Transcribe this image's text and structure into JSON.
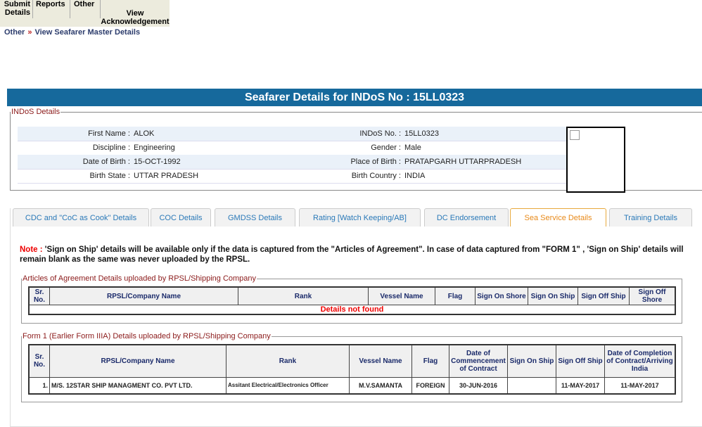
{
  "menu": [
    "Submit Details",
    "Reports",
    "Other",
    "View Acknowledgement"
  ],
  "breadcrumb": {
    "parent": "Other",
    "sep": "»",
    "current": "View Seafarer Master Details"
  },
  "title": "Seafarer Details for INDoS No : 15LL0323",
  "indos": {
    "legend": "INDoS Details",
    "rows": [
      {
        "l1": "First Name :",
        "v1": "ALOK",
        "l2": "INDoS No. :",
        "v2": "15LL0323"
      },
      {
        "l1": "Discipline :",
        "v1": "Engineering",
        "l2": "Gender :",
        "v2": "Male"
      },
      {
        "l1": "Date of Birth :",
        "v1": "15-OCT-1992",
        "l2": "Place of Birth :",
        "v2": "PRATAPGARH UTTARPRADESH"
      },
      {
        "l1": "Birth State :",
        "v1": "UTTAR PRADESH",
        "l2": "Birth Country :",
        "v2": "INDIA"
      }
    ]
  },
  "tabs": [
    "CDC and \"CoC as Cook\" Details",
    "COC Details",
    "GMDSS Details",
    "Rating [Watch Keeping/AB]",
    "DC Endorsement",
    "Sea Service Details",
    "Training Details"
  ],
  "note": {
    "label": "Note :",
    "text": " 'Sign on Ship' details will be available only if the data is captured from the \"Articles of Agreement\". In case of data captured from \"FORM 1\" , 'Sign on Ship' details will remain blank as the same was never uploaded by the RPSL."
  },
  "articles": {
    "legend": "Articles of Agreement Details uploaded by RPSL/Shipping Company",
    "headers": [
      "Sr. No.",
      "RPSL/Company Name",
      "Rank",
      "Vessel Name",
      "Flag",
      "Sign On Shore",
      "Sign On Ship",
      "Sign Off Ship",
      "Sign Off Shore"
    ],
    "empty": "Details not found"
  },
  "form1": {
    "legend": "Form 1 (Earlier Form IIIA) Details uploaded by RPSL/Shipping Company",
    "headers": [
      "Sr. No.",
      "RPSL/Company Name",
      "Rank",
      "Vessel Name",
      "Flag",
      "Date of Commencement of Contract",
      "Sign On Ship",
      "Sign Off Ship",
      "Date of Completion of Contract/Arriving India"
    ],
    "rows": [
      [
        "1.",
        "M/S. 12STAR SHIP MANAGMENT CO. PVT LTD.",
        "Assitant Electrical/Electronics Officer",
        "M.V.SAMANTA",
        "FOREIGN",
        "30-JUN-2016",
        "",
        "11-MAY-2017",
        "11-MAY-2017"
      ]
    ]
  }
}
